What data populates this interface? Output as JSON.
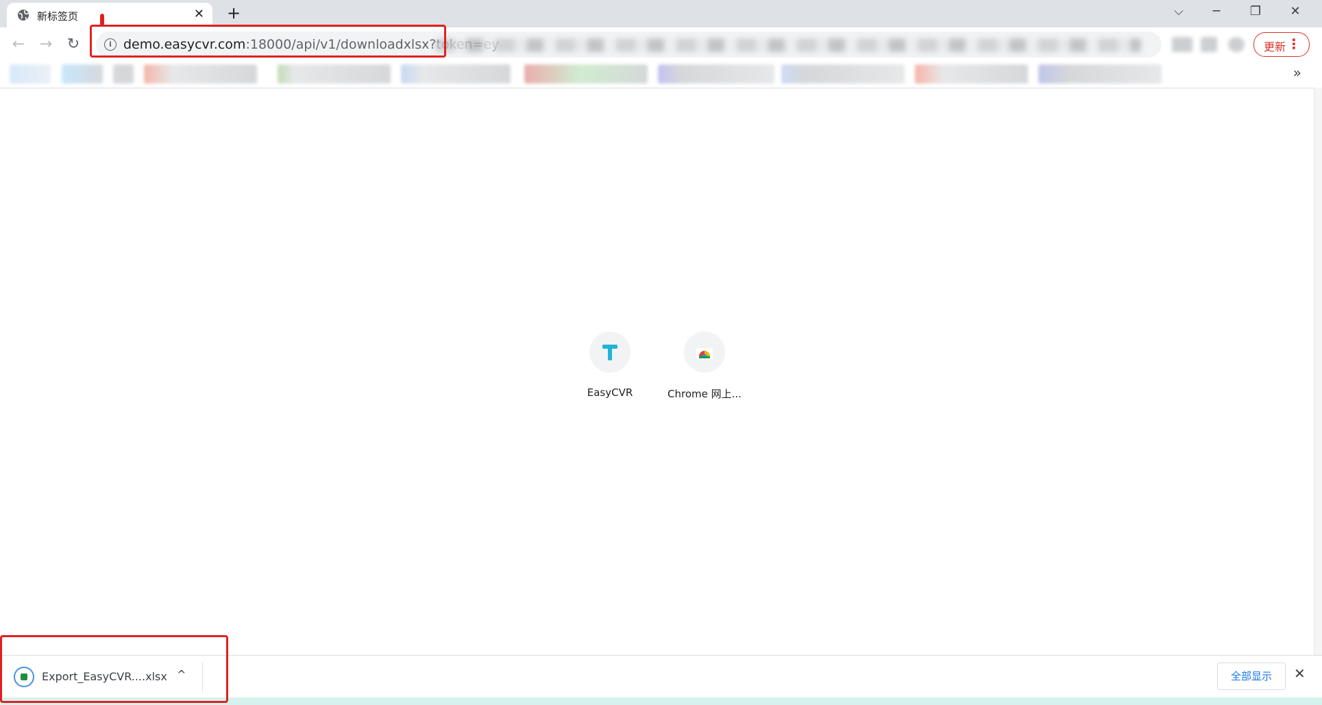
{
  "browser": {
    "tab": {
      "title": "新标签页",
      "close_glyph": "✕",
      "favicon": "globe-icon"
    },
    "new_tab_glyph": "+",
    "window_controls": {
      "tab_search": "⌵",
      "minimize": "─",
      "restore": "❐",
      "close": "✕"
    },
    "nav": {
      "back": "←",
      "forward": "→",
      "reload": "↻"
    },
    "address": {
      "info_glyph": "i",
      "host": "demo.easycvr.com",
      "rest": ":18000/api/v1/downloadxlsx?token=ey"
    },
    "update_button": {
      "label": "更新",
      "menu_glyph": "⋮"
    },
    "bookmarks_overflow": "»"
  },
  "new_tab_page": {
    "shortcuts": [
      {
        "label": "EasyCVR",
        "icon": "easycvr-logo-icon"
      },
      {
        "label": "Chrome 网上...",
        "icon": "chrome-webstore-icon"
      }
    ]
  },
  "downloads": {
    "item": {
      "filename": "Export_EasyCVR....xlsx",
      "caret": "^"
    },
    "show_all": "全部显示",
    "close_glyph": "✕"
  },
  "colors": {
    "annotation": "#e02020",
    "link": "#1a73e8",
    "easycvr_brand": "#21b3d6"
  }
}
